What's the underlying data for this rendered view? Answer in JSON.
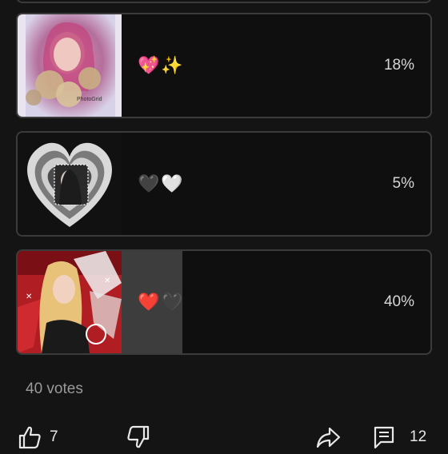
{
  "poll": {
    "options": [
      {
        "emoji": "💖✨",
        "percent": "18%",
        "fraction": 0.18,
        "thumb_caption": "PhotoGrid"
      },
      {
        "emoji": "🖤🤍",
        "percent": "5%",
        "fraction": 0.05
      },
      {
        "emoji": "❤️🖤",
        "percent": "40%",
        "fraction": 0.4
      }
    ],
    "votes_label": "40 votes"
  },
  "actions": {
    "like_count": "7",
    "comment_count": "12"
  },
  "colors": {
    "background": "#141414",
    "bar_fill": "#3d3d3d",
    "border": "#3b3b3b"
  }
}
